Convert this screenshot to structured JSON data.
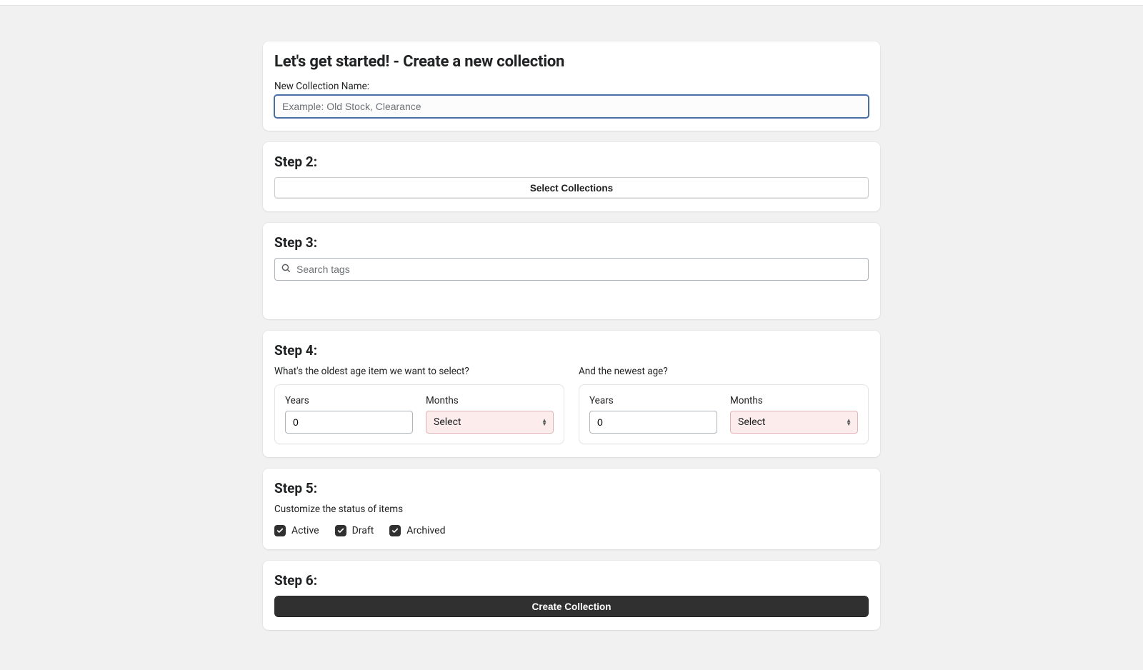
{
  "step1": {
    "title": "Let's get started! - Create a new collection",
    "label": "New Collection Name:",
    "placeholder": "Example: Old Stock, Clearance",
    "value": ""
  },
  "step2": {
    "title": "Step 2:",
    "button": "Select Collections"
  },
  "step3": {
    "title": "Step 3:",
    "placeholder": "Search tags"
  },
  "step4": {
    "title": "Step 4:",
    "oldest_label": "What's the oldest age item we want to select?",
    "newest_label": "And the newest age?",
    "years_label": "Years",
    "months_label": "Months",
    "oldest_years": "0",
    "newest_years": "0",
    "months_select": "Select"
  },
  "step5": {
    "title": "Step 5:",
    "subtitle": "Customize the status of items",
    "checks": {
      "active": "Active",
      "draft": "Draft",
      "archived": "Archived"
    }
  },
  "step6": {
    "title": "Step 6:",
    "button": "Create Collection"
  }
}
